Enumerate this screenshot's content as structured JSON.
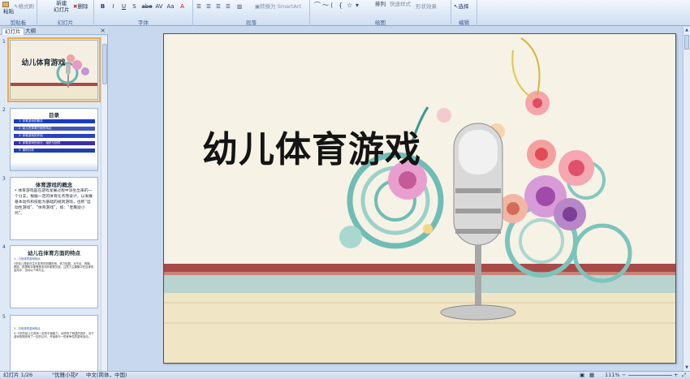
{
  "ribbon": {
    "clipboard": {
      "paste": "粘贴",
      "format_painter": "格式刷",
      "label": "剪贴板"
    },
    "slides": {
      "new_slide_line1": "新建",
      "new_slide_line2": "幻灯片",
      "delete": "删除",
      "label": "幻灯片"
    },
    "font": {
      "label": "字体",
      "buttons": [
        "B",
        "I",
        "U",
        "S",
        "abe",
        "AV",
        "Aa",
        "A"
      ]
    },
    "paragraph": {
      "label": "段落",
      "smartart": "转换为 SmartArt"
    },
    "drawing": {
      "label": "绘图",
      "arrange": "排列",
      "quick_styles": "快速样式",
      "shape_effects": "形状效果"
    },
    "editing": {
      "label": "编辑",
      "select": "选择"
    }
  },
  "panel": {
    "tabs": [
      "幻灯片",
      "大纲"
    ],
    "close": "×"
  },
  "thumbnails": [
    {
      "num": "1",
      "title": "幼儿体育游戏"
    },
    {
      "num": "2",
      "title": "目录",
      "items": [
        "1. 体育游戏的概念",
        "2. 幼儿在体育方面的特点",
        "3. 体育游戏的作用",
        "4. 体育游戏的设计、组织与指导",
        "5. 案例分析"
      ]
    },
    {
      "num": "3",
      "title": "体育游戏的概念",
      "body": "• 体育游戏是在游戏发展过程中派生出来的一个分支，根据一定的体育任务而设计，以发展基本动作和技能为基础的规则游戏，也称“运动性游戏”、“体育游戏”，如：“老鹰捉小鸡”。"
    },
    {
      "num": "4",
      "title": "幼儿在体育方面的特点",
      "heading": "1、小班体育游戏特点",
      "body": "3岁幼儿是处在生长发育的初期阶段，体力较弱，对于走、奔跑、跳跃、投掷和平衡等基本动作都很欠缺，注意力主要集中在自身的运动中，活动以个体为主。"
    },
    {
      "num": "5",
      "heading": "2、中班体育游戏特点",
      "body": "4~5岁的幼儿已具有一定的平衡能力，动作有了明显的进步，对于游戏的规则有了一定的认识，开始参与一些竞争性的游戏活动。"
    }
  ],
  "slide": {
    "title": "幼儿体育游戏"
  },
  "status": {
    "slide_info": "幻灯片 1/26",
    "theme": "\"优雅小花\"",
    "language": "中文(简体，中国)",
    "zoom": "111%"
  },
  "colors": {
    "ribbon_bg": "#dbe7f6",
    "thumb_menu_item": "#1f3fb0",
    "selected_outline": "#f4a840"
  }
}
